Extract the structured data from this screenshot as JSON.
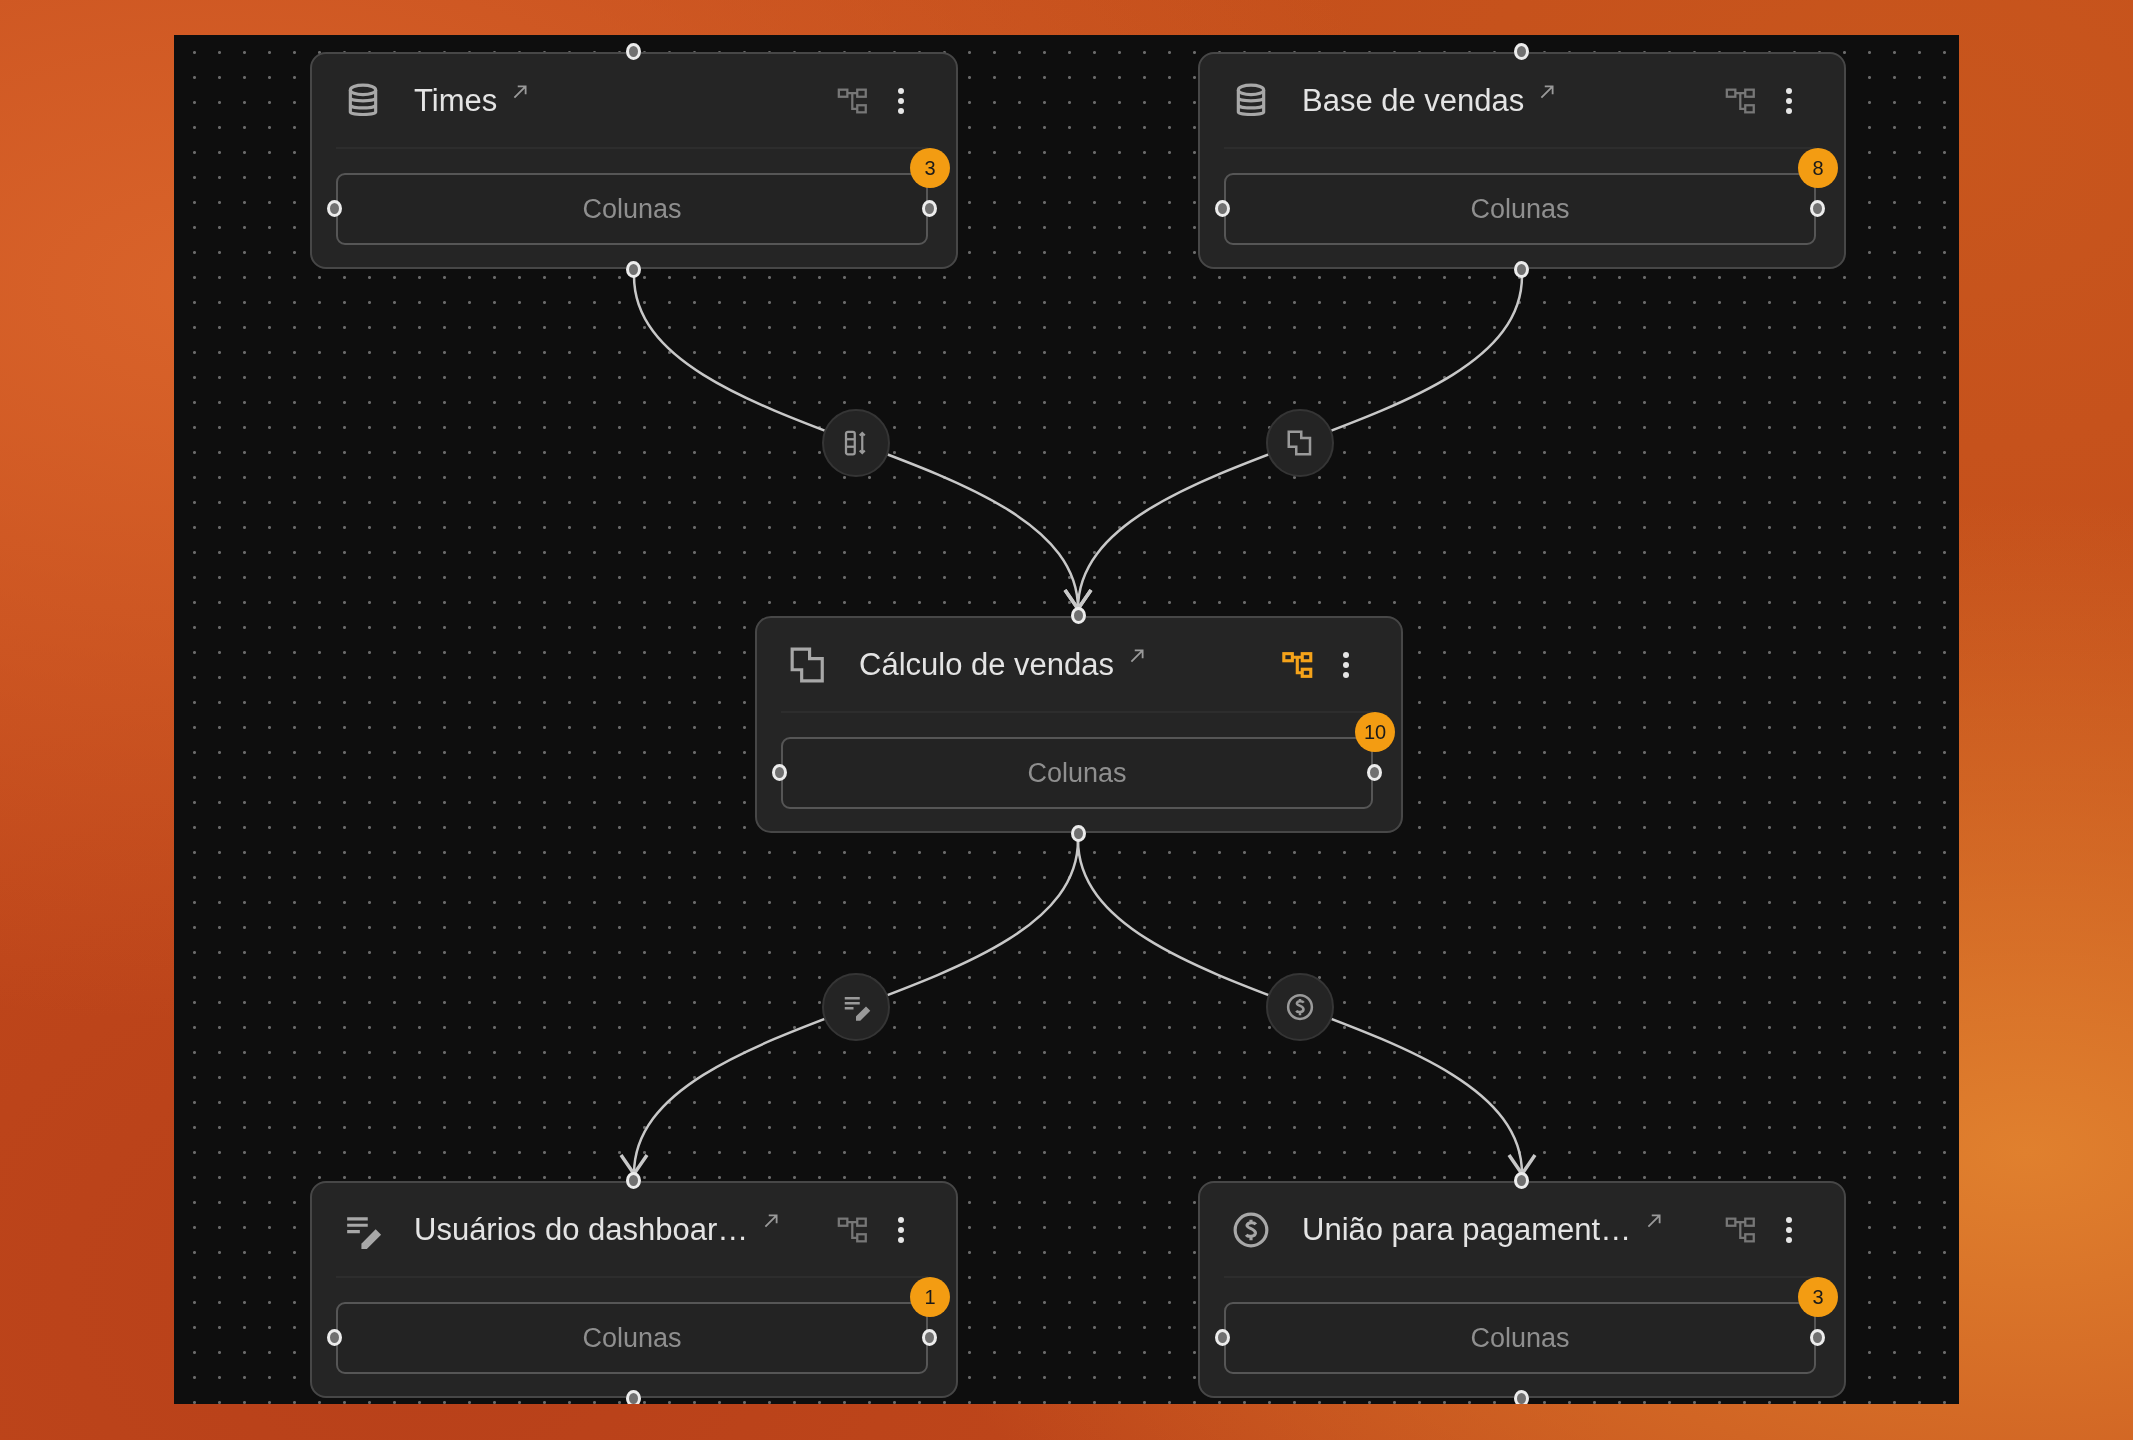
{
  "nodes": [
    {
      "title": "Times",
      "kind": "database",
      "lineage_active": false,
      "port": {
        "label": "Colunas",
        "count": "3"
      }
    },
    {
      "title": "Base de vendas",
      "kind": "database",
      "lineage_active": false,
      "port": {
        "label": "Colunas",
        "count": "8"
      }
    },
    {
      "title": "Cálculo de vendas",
      "kind": "merge",
      "lineage_active": true,
      "port": {
        "label": "Colunas",
        "count": "10"
      }
    },
    {
      "title": "Usuários do dashboar…",
      "kind": "edit",
      "lineage_active": false,
      "port": {
        "label": "Colunas",
        "count": "1"
      }
    },
    {
      "title": "União para pagament…",
      "kind": "dollar",
      "lineage_active": false,
      "port": {
        "label": "Colunas",
        "count": "3"
      }
    }
  ],
  "edges": [
    {
      "kind": "columns"
    },
    {
      "kind": "merge"
    },
    {
      "kind": "edit"
    },
    {
      "kind": "dollar"
    }
  ]
}
